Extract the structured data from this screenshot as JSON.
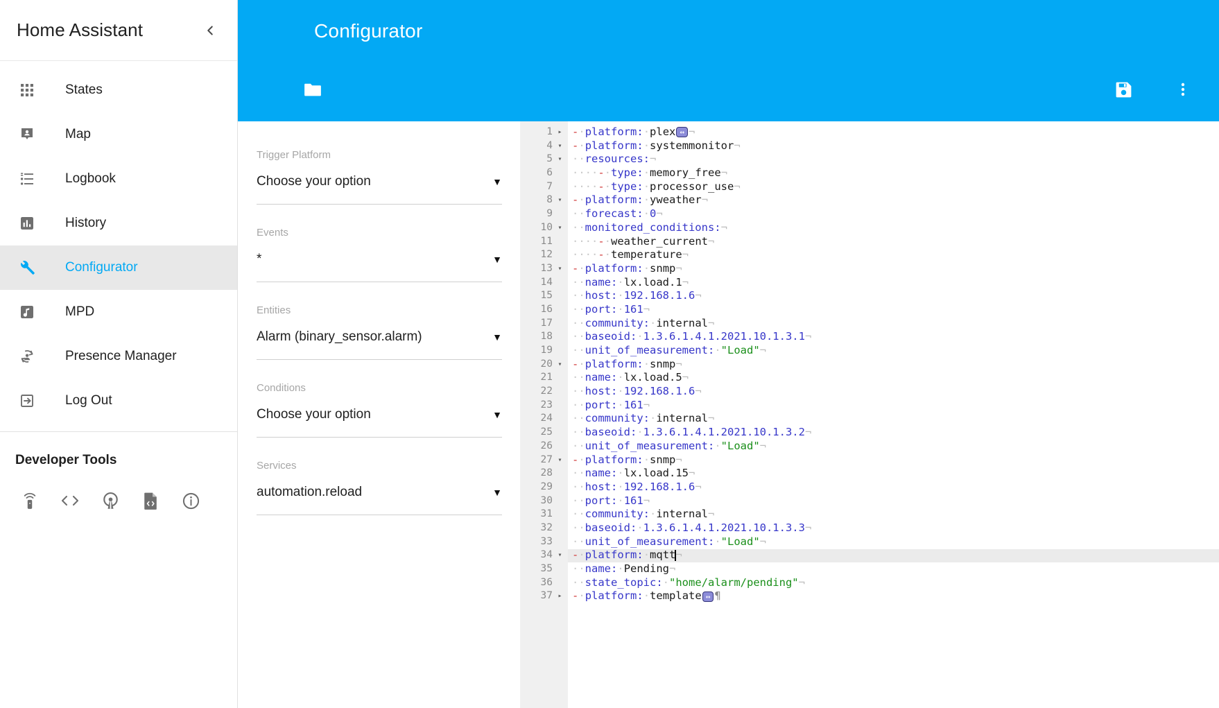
{
  "sidebar": {
    "title": "Home Assistant",
    "collapse_icon": "chevron-left-icon",
    "items": [
      {
        "label": "States",
        "icon": "apps-grid-icon",
        "active": false
      },
      {
        "label": "Map",
        "icon": "map-marker-account-icon",
        "active": false
      },
      {
        "label": "Logbook",
        "icon": "format-list-bulleted-icon",
        "active": false
      },
      {
        "label": "History",
        "icon": "chart-box-icon",
        "active": false
      },
      {
        "label": "Configurator",
        "icon": "wrench-icon",
        "active": true
      },
      {
        "label": "MPD",
        "icon": "music-note-box-icon",
        "active": false
      },
      {
        "label": "Presence Manager",
        "icon": "account-sync-icon",
        "active": false
      },
      {
        "label": "Log Out",
        "icon": "exit-to-app-icon",
        "active": false
      }
    ],
    "developer_tools": {
      "title": "Developer Tools",
      "icons": [
        "remote-icon",
        "code-tags-icon",
        "broadcast-icon",
        "file-code-icon",
        "information-outline-icon"
      ]
    }
  },
  "toolbar": {
    "title": "Configurator",
    "accent_color": "#03a9f4",
    "browse_label": "folder-icon",
    "save_label": "content-save-icon",
    "menu_label": "dots-vertical-icon"
  },
  "form": {
    "fields": [
      {
        "label": "Trigger Platform",
        "value": "Choose your option",
        "caret": "▼"
      },
      {
        "label": "Events",
        "value": "*",
        "caret": "▼"
      },
      {
        "label": "Entities",
        "value": "Alarm (binary_sensor.alarm)",
        "caret": "▼"
      },
      {
        "label": "Conditions",
        "value": "Choose your option",
        "caret": "▼"
      },
      {
        "label": "Services",
        "value": "automation.reload",
        "caret": "▼"
      }
    ]
  },
  "editor": {
    "language": "yaml",
    "active_line": 34,
    "cursor_line": 34,
    "fold_collapsed_glyph": "▸",
    "fold_expanded_glyph": "▾",
    "whitespace_dot": "·",
    "eol_marker": "¬",
    "eof_marker": "¶",
    "fold_widget_glyph": "↔",
    "lines": [
      {
        "n": 1,
        "fold": "collapsed",
        "tokens": [
          {
            "t": "dash",
            "v": "-"
          },
          {
            "t": "ws",
            "v": "·"
          },
          {
            "t": "key",
            "v": "platform:"
          },
          {
            "t": "ws",
            "v": "·"
          },
          {
            "t": "val",
            "v": "plex"
          },
          {
            "t": "foldwidget",
            "v": "↔"
          },
          {
            "t": "eol",
            "v": "¬"
          }
        ]
      },
      {
        "n": 4,
        "fold": "expanded",
        "tokens": [
          {
            "t": "dash",
            "v": "-"
          },
          {
            "t": "ws",
            "v": "·"
          },
          {
            "t": "key",
            "v": "platform:"
          },
          {
            "t": "ws",
            "v": "·"
          },
          {
            "t": "val",
            "v": "systemmonitor"
          },
          {
            "t": "eol",
            "v": "¬"
          }
        ]
      },
      {
        "n": 5,
        "fold": "expanded",
        "tokens": [
          {
            "t": "ws",
            "v": "··"
          },
          {
            "t": "key",
            "v": "resources:"
          },
          {
            "t": "eol",
            "v": "¬"
          }
        ]
      },
      {
        "n": 6,
        "fold": "none",
        "tokens": [
          {
            "t": "ws",
            "v": "····"
          },
          {
            "t": "dash",
            "v": "-"
          },
          {
            "t": "ws",
            "v": "·"
          },
          {
            "t": "key",
            "v": "type:"
          },
          {
            "t": "ws",
            "v": "·"
          },
          {
            "t": "val",
            "v": "memory_free"
          },
          {
            "t": "eol",
            "v": "¬"
          }
        ]
      },
      {
        "n": 7,
        "fold": "none",
        "tokens": [
          {
            "t": "ws",
            "v": "····"
          },
          {
            "t": "dash",
            "v": "-"
          },
          {
            "t": "ws",
            "v": "·"
          },
          {
            "t": "key",
            "v": "type:"
          },
          {
            "t": "ws",
            "v": "·"
          },
          {
            "t": "val",
            "v": "processor_use"
          },
          {
            "t": "eol",
            "v": "¬"
          }
        ]
      },
      {
        "n": 8,
        "fold": "expanded",
        "tokens": [
          {
            "t": "dash",
            "v": "-"
          },
          {
            "t": "ws",
            "v": "·"
          },
          {
            "t": "key",
            "v": "platform:"
          },
          {
            "t": "ws",
            "v": "·"
          },
          {
            "t": "val",
            "v": "yweather"
          },
          {
            "t": "eol",
            "v": "¬"
          }
        ]
      },
      {
        "n": 9,
        "fold": "none",
        "tokens": [
          {
            "t": "ws",
            "v": "··"
          },
          {
            "t": "key",
            "v": "forecast:"
          },
          {
            "t": "ws",
            "v": "·"
          },
          {
            "t": "num",
            "v": "0"
          },
          {
            "t": "eol",
            "v": "¬"
          }
        ]
      },
      {
        "n": 10,
        "fold": "expanded",
        "tokens": [
          {
            "t": "ws",
            "v": "··"
          },
          {
            "t": "key",
            "v": "monitored_conditions:"
          },
          {
            "t": "eol",
            "v": "¬"
          }
        ]
      },
      {
        "n": 11,
        "fold": "none",
        "tokens": [
          {
            "t": "ws",
            "v": "····"
          },
          {
            "t": "dash",
            "v": "-"
          },
          {
            "t": "ws",
            "v": "·"
          },
          {
            "t": "val",
            "v": "weather_current"
          },
          {
            "t": "eol",
            "v": "¬"
          }
        ]
      },
      {
        "n": 12,
        "fold": "none",
        "tokens": [
          {
            "t": "ws",
            "v": "····"
          },
          {
            "t": "dash",
            "v": "-"
          },
          {
            "t": "ws",
            "v": "·"
          },
          {
            "t": "val",
            "v": "temperature"
          },
          {
            "t": "eol",
            "v": "¬"
          }
        ]
      },
      {
        "n": 13,
        "fold": "expanded",
        "tokens": [
          {
            "t": "dash",
            "v": "-"
          },
          {
            "t": "ws",
            "v": "·"
          },
          {
            "t": "key",
            "v": "platform:"
          },
          {
            "t": "ws",
            "v": "·"
          },
          {
            "t": "val",
            "v": "snmp"
          },
          {
            "t": "eol",
            "v": "¬"
          }
        ]
      },
      {
        "n": 14,
        "fold": "none",
        "tokens": [
          {
            "t": "ws",
            "v": "··"
          },
          {
            "t": "key",
            "v": "name:"
          },
          {
            "t": "ws",
            "v": "·"
          },
          {
            "t": "val",
            "v": "lx.load.1"
          },
          {
            "t": "eol",
            "v": "¬"
          }
        ]
      },
      {
        "n": 15,
        "fold": "none",
        "tokens": [
          {
            "t": "ws",
            "v": "··"
          },
          {
            "t": "key",
            "v": "host:"
          },
          {
            "t": "ws",
            "v": "·"
          },
          {
            "t": "num",
            "v": "192.168.1.6"
          },
          {
            "t": "eol",
            "v": "¬"
          }
        ]
      },
      {
        "n": 16,
        "fold": "none",
        "tokens": [
          {
            "t": "ws",
            "v": "··"
          },
          {
            "t": "key",
            "v": "port:"
          },
          {
            "t": "ws",
            "v": "·"
          },
          {
            "t": "num",
            "v": "161"
          },
          {
            "t": "eol",
            "v": "¬"
          }
        ]
      },
      {
        "n": 17,
        "fold": "none",
        "tokens": [
          {
            "t": "ws",
            "v": "··"
          },
          {
            "t": "key",
            "v": "community:"
          },
          {
            "t": "ws",
            "v": "·"
          },
          {
            "t": "val",
            "v": "internal"
          },
          {
            "t": "eol",
            "v": "¬"
          }
        ]
      },
      {
        "n": 18,
        "fold": "none",
        "tokens": [
          {
            "t": "ws",
            "v": "··"
          },
          {
            "t": "key",
            "v": "baseoid:"
          },
          {
            "t": "ws",
            "v": "·"
          },
          {
            "t": "num",
            "v": "1.3.6.1.4.1.2021.10.1.3.1"
          },
          {
            "t": "eol",
            "v": "¬"
          }
        ]
      },
      {
        "n": 19,
        "fold": "none",
        "tokens": [
          {
            "t": "ws",
            "v": "··"
          },
          {
            "t": "key",
            "v": "unit_of_measurement:"
          },
          {
            "t": "ws",
            "v": "·"
          },
          {
            "t": "str",
            "v": "\"Load\""
          },
          {
            "t": "eol",
            "v": "¬"
          }
        ]
      },
      {
        "n": 20,
        "fold": "expanded",
        "tokens": [
          {
            "t": "dash",
            "v": "-"
          },
          {
            "t": "ws",
            "v": "·"
          },
          {
            "t": "key",
            "v": "platform:"
          },
          {
            "t": "ws",
            "v": "·"
          },
          {
            "t": "val",
            "v": "snmp"
          },
          {
            "t": "eol",
            "v": "¬"
          }
        ]
      },
      {
        "n": 21,
        "fold": "none",
        "tokens": [
          {
            "t": "ws",
            "v": "··"
          },
          {
            "t": "key",
            "v": "name:"
          },
          {
            "t": "ws",
            "v": "·"
          },
          {
            "t": "val",
            "v": "lx.load.5"
          },
          {
            "t": "eol",
            "v": "¬"
          }
        ]
      },
      {
        "n": 22,
        "fold": "none",
        "tokens": [
          {
            "t": "ws",
            "v": "··"
          },
          {
            "t": "key",
            "v": "host:"
          },
          {
            "t": "ws",
            "v": "·"
          },
          {
            "t": "num",
            "v": "192.168.1.6"
          },
          {
            "t": "eol",
            "v": "¬"
          }
        ]
      },
      {
        "n": 23,
        "fold": "none",
        "tokens": [
          {
            "t": "ws",
            "v": "··"
          },
          {
            "t": "key",
            "v": "port:"
          },
          {
            "t": "ws",
            "v": "·"
          },
          {
            "t": "num",
            "v": "161"
          },
          {
            "t": "eol",
            "v": "¬"
          }
        ]
      },
      {
        "n": 24,
        "fold": "none",
        "tokens": [
          {
            "t": "ws",
            "v": "··"
          },
          {
            "t": "key",
            "v": "community:"
          },
          {
            "t": "ws",
            "v": "·"
          },
          {
            "t": "val",
            "v": "internal"
          },
          {
            "t": "eol",
            "v": "¬"
          }
        ]
      },
      {
        "n": 25,
        "fold": "none",
        "tokens": [
          {
            "t": "ws",
            "v": "··"
          },
          {
            "t": "key",
            "v": "baseoid:"
          },
          {
            "t": "ws",
            "v": "·"
          },
          {
            "t": "num",
            "v": "1.3.6.1.4.1.2021.10.1.3.2"
          },
          {
            "t": "eol",
            "v": "¬"
          }
        ]
      },
      {
        "n": 26,
        "fold": "none",
        "tokens": [
          {
            "t": "ws",
            "v": "··"
          },
          {
            "t": "key",
            "v": "unit_of_measurement:"
          },
          {
            "t": "ws",
            "v": "·"
          },
          {
            "t": "str",
            "v": "\"Load\""
          },
          {
            "t": "eol",
            "v": "¬"
          }
        ]
      },
      {
        "n": 27,
        "fold": "expanded",
        "tokens": [
          {
            "t": "dash",
            "v": "-"
          },
          {
            "t": "ws",
            "v": "·"
          },
          {
            "t": "key",
            "v": "platform:"
          },
          {
            "t": "ws",
            "v": "·"
          },
          {
            "t": "val",
            "v": "snmp"
          },
          {
            "t": "eol",
            "v": "¬"
          }
        ]
      },
      {
        "n": 28,
        "fold": "none",
        "tokens": [
          {
            "t": "ws",
            "v": "··"
          },
          {
            "t": "key",
            "v": "name:"
          },
          {
            "t": "ws",
            "v": "·"
          },
          {
            "t": "val",
            "v": "lx.load.15"
          },
          {
            "t": "eol",
            "v": "¬"
          }
        ]
      },
      {
        "n": 29,
        "fold": "none",
        "tokens": [
          {
            "t": "ws",
            "v": "··"
          },
          {
            "t": "key",
            "v": "host:"
          },
          {
            "t": "ws",
            "v": "·"
          },
          {
            "t": "num",
            "v": "192.168.1.6"
          },
          {
            "t": "eol",
            "v": "¬"
          }
        ]
      },
      {
        "n": 30,
        "fold": "none",
        "tokens": [
          {
            "t": "ws",
            "v": "··"
          },
          {
            "t": "key",
            "v": "port:"
          },
          {
            "t": "ws",
            "v": "·"
          },
          {
            "t": "num",
            "v": "161"
          },
          {
            "t": "eol",
            "v": "¬"
          }
        ]
      },
      {
        "n": 31,
        "fold": "none",
        "tokens": [
          {
            "t": "ws",
            "v": "··"
          },
          {
            "t": "key",
            "v": "community:"
          },
          {
            "t": "ws",
            "v": "·"
          },
          {
            "t": "val",
            "v": "internal"
          },
          {
            "t": "eol",
            "v": "¬"
          }
        ]
      },
      {
        "n": 32,
        "fold": "none",
        "tokens": [
          {
            "t": "ws",
            "v": "··"
          },
          {
            "t": "key",
            "v": "baseoid:"
          },
          {
            "t": "ws",
            "v": "·"
          },
          {
            "t": "num",
            "v": "1.3.6.1.4.1.2021.10.1.3.3"
          },
          {
            "t": "eol",
            "v": "¬"
          }
        ]
      },
      {
        "n": 33,
        "fold": "none",
        "tokens": [
          {
            "t": "ws",
            "v": "··"
          },
          {
            "t": "key",
            "v": "unit_of_measurement:"
          },
          {
            "t": "ws",
            "v": "·"
          },
          {
            "t": "str",
            "v": "\"Load\""
          },
          {
            "t": "eol",
            "v": "¬"
          }
        ]
      },
      {
        "n": 34,
        "fold": "expanded",
        "active": true,
        "tokens": [
          {
            "t": "dash",
            "v": "-"
          },
          {
            "t": "ws",
            "v": "·"
          },
          {
            "t": "key",
            "v": "platform:"
          },
          {
            "t": "ws",
            "v": "·"
          },
          {
            "t": "val",
            "v": "mqtt"
          },
          {
            "t": "caret",
            "v": ""
          },
          {
            "t": "eol",
            "v": "¬"
          }
        ]
      },
      {
        "n": 35,
        "fold": "none",
        "tokens": [
          {
            "t": "ws",
            "v": "··"
          },
          {
            "t": "key",
            "v": "name:"
          },
          {
            "t": "ws",
            "v": "·"
          },
          {
            "t": "val",
            "v": "Pending"
          },
          {
            "t": "eol",
            "v": "¬"
          }
        ]
      },
      {
        "n": 36,
        "fold": "none",
        "tokens": [
          {
            "t": "ws",
            "v": "··"
          },
          {
            "t": "key",
            "v": "state_topic:"
          },
          {
            "t": "ws",
            "v": "·"
          },
          {
            "t": "str",
            "v": "\"home/alarm/pending\""
          },
          {
            "t": "eol",
            "v": "¬"
          }
        ]
      },
      {
        "n": 37,
        "fold": "collapsed",
        "tokens": [
          {
            "t": "dash",
            "v": "-"
          },
          {
            "t": "ws",
            "v": "·"
          },
          {
            "t": "key",
            "v": "platform:"
          },
          {
            "t": "ws",
            "v": "·"
          },
          {
            "t": "val",
            "v": "template"
          },
          {
            "t": "foldwidget",
            "v": "↔"
          },
          {
            "t": "pilcrow",
            "v": "¶"
          }
        ]
      }
    ]
  }
}
